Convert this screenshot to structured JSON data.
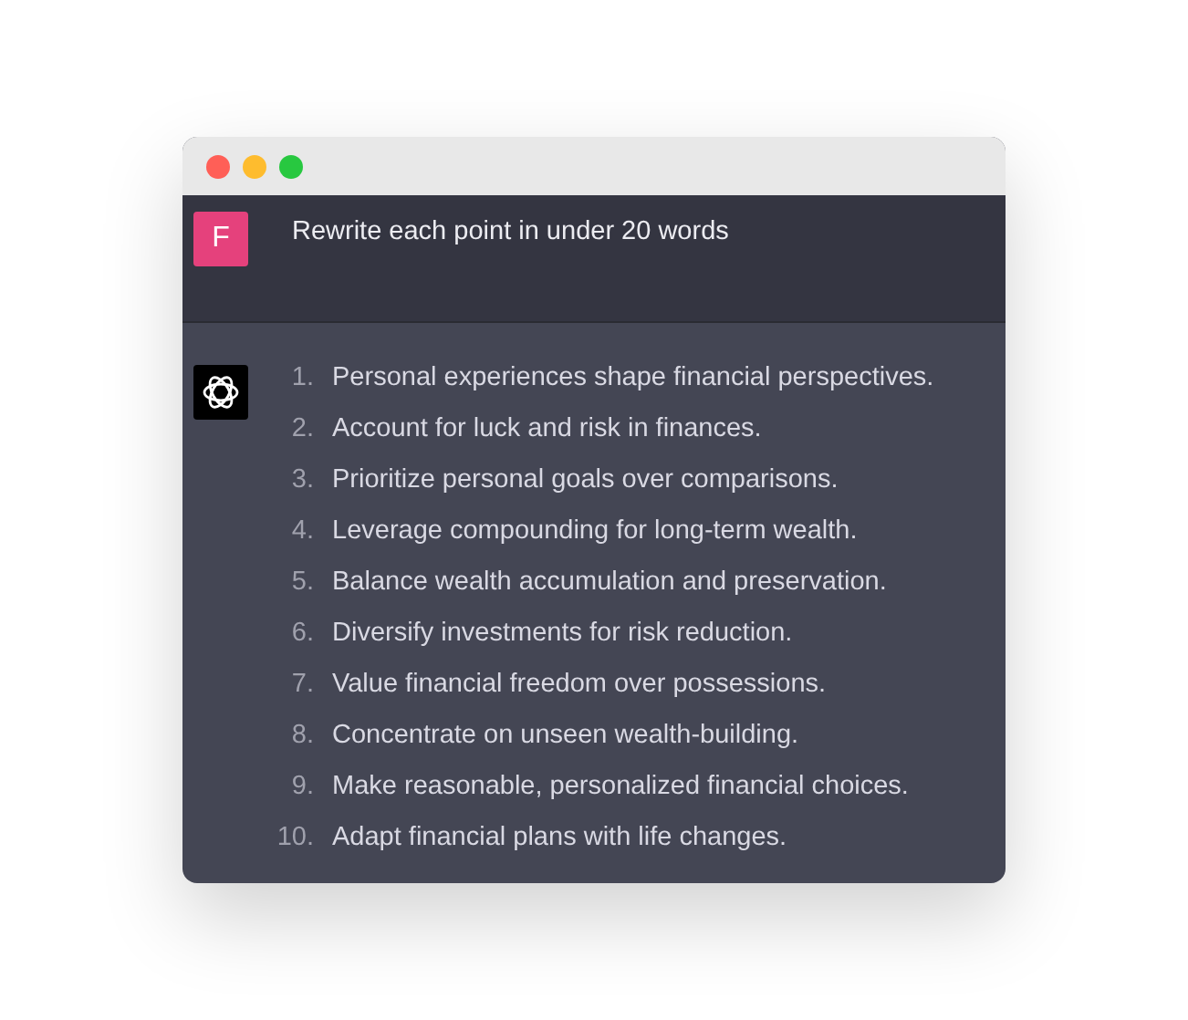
{
  "window": {
    "controls": [
      {
        "color": "#ff5f57"
      },
      {
        "color": "#febc2e"
      },
      {
        "color": "#28c840"
      }
    ]
  },
  "messages": [
    {
      "kind": "user",
      "avatar": "F",
      "text": "Rewrite each point in under 20 words"
    },
    {
      "kind": "assistant",
      "items": [
        {
          "number": "1.",
          "text": "Personal experiences shape financial perspectives."
        },
        {
          "number": "2.",
          "text": "Account for luck and risk in finances."
        },
        {
          "number": "3.",
          "text": "Prioritize personal goals over comparisons."
        },
        {
          "number": "4.",
          "text": "Leverage compounding for long-term wealth."
        },
        {
          "number": "5.",
          "text": "Balance wealth accumulation and preservation."
        },
        {
          "number": "6.",
          "text": "Diversify investments for risk reduction."
        },
        {
          "number": "7.",
          "text": "Value financial freedom over possessions."
        },
        {
          "number": "8.",
          "text": "Concentrate on unseen wealth-building."
        },
        {
          "number": "9.",
          "text": "Make reasonable, personalized financial choices."
        },
        {
          "number": "10.",
          "text": "Adapt financial plans with life changes."
        }
      ]
    }
  ]
}
